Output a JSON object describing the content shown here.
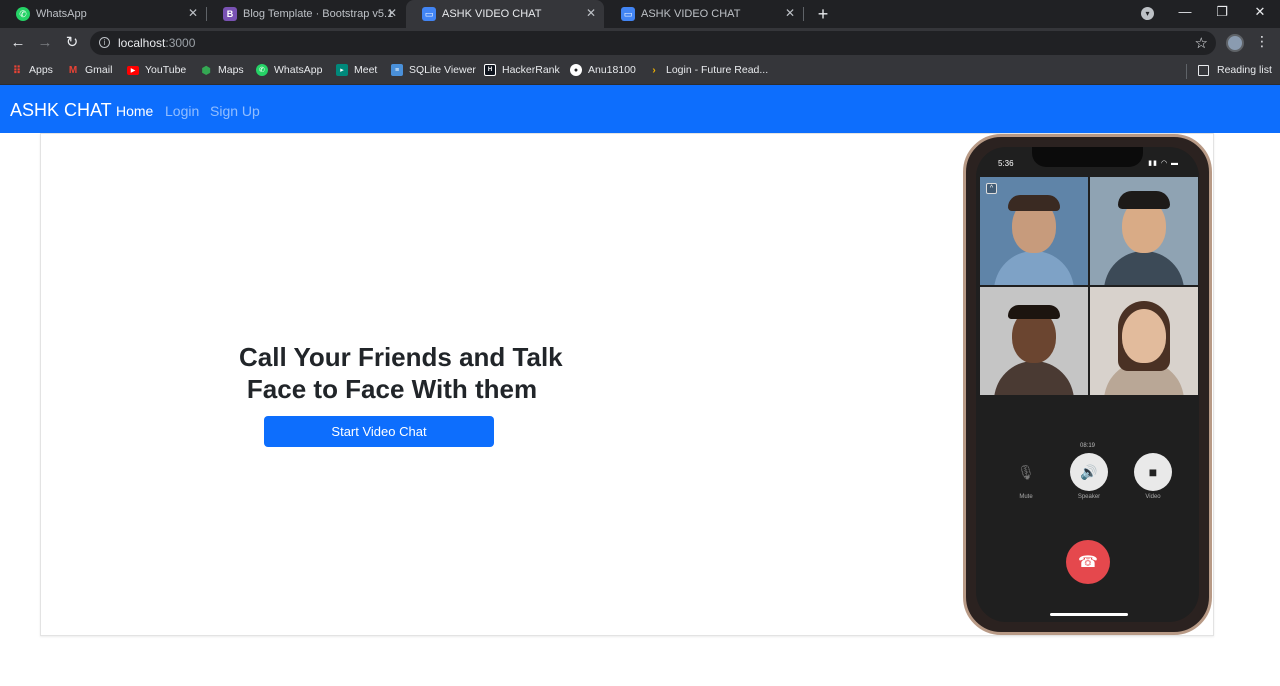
{
  "browser": {
    "tabs": [
      {
        "title": "WhatsApp",
        "icon": "whatsapp-icon",
        "color": "#25d366"
      },
      {
        "title": "Blog Template · Bootstrap v5.1",
        "icon": "bootstrap-icon",
        "color": "#7952b3",
        "glyph": "B"
      },
      {
        "title": "ASHK VIDEO CHAT",
        "icon": "video-chat-icon",
        "color": "#4285f4",
        "active": true
      },
      {
        "title": "ASHK VIDEO CHAT",
        "icon": "video-chat-icon",
        "color": "#4285f4"
      }
    ],
    "new_tab": "+",
    "address": {
      "host": "localhost",
      "port": ":3000"
    },
    "bookmarks": [
      {
        "label": "Apps",
        "icon": "apps-grid-icon",
        "color": "#ea4335"
      },
      {
        "label": "Gmail",
        "icon": "gmail-icon",
        "color": "#ea4335"
      },
      {
        "label": "YouTube",
        "icon": "youtube-icon",
        "color": "#ff0000"
      },
      {
        "label": "Maps",
        "icon": "maps-icon",
        "color": "#34a853"
      },
      {
        "label": "WhatsApp",
        "icon": "whatsapp-icon",
        "color": "#25d366"
      },
      {
        "label": "Meet",
        "icon": "meet-icon",
        "color": "#00897b"
      },
      {
        "label": "SQLite Viewer",
        "icon": "sqlite-icon",
        "color": "#4a90d9"
      },
      {
        "label": "HackerRank",
        "icon": "hackerrank-icon",
        "color": "#1ba94c"
      },
      {
        "label": "Anu18100",
        "icon": "github-icon",
        "color": "#ffffff"
      },
      {
        "label": "Login - Future Read...",
        "icon": "future-read-icon",
        "color": "#f4b400"
      }
    ],
    "reading_list": "Reading list"
  },
  "navbar": {
    "brand": "ASHK CHAT",
    "links": [
      {
        "label": "Home",
        "active": true
      },
      {
        "label": "Login"
      },
      {
        "label": "Sign Up"
      }
    ],
    "background": "#0d6efd"
  },
  "hero": {
    "headline_line1": "Call Your Friends and Talk",
    "headline_line2": "Face to Face With them",
    "cta": "Start Video Chat"
  },
  "phone_mock": {
    "status_time": "5:36",
    "call_timer": "08:19",
    "controls": [
      {
        "label": "Mute",
        "icon": "microphone-icon"
      },
      {
        "label": "Speaker",
        "icon": "speaker-icon"
      },
      {
        "label": "Video",
        "icon": "video-camera-icon"
      }
    ],
    "end_call_icon": "end-call-icon"
  }
}
